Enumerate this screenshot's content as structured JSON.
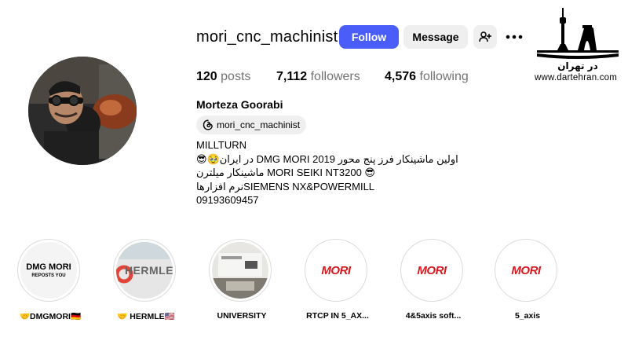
{
  "profile": {
    "username": "mori_cnc_machinist",
    "follow_label": "Follow",
    "message_label": "Message",
    "posts_count": "120",
    "posts_label": "posts",
    "followers_count": "7,112",
    "followers_label": "followers",
    "following_count": "4,576",
    "following_label": "following",
    "full_name": "Morteza Goorabi",
    "threads_handle": "mori_cnc_machinist",
    "bio_lines": [
      "MILLTURN",
      "😎🥹در ایران DMG MORI اولین ماشینکار فرز پنج محور 2019",
      "ماشینکار میلترن MORI SEIKI NT3200 😎",
      "نرم افزارهاSIEMENS NX&POWERMILL",
      "09193609457"
    ]
  },
  "highlights": [
    {
      "label": "🤝DMGMORI🇩🇪",
      "thumb_text": "DMG MORI",
      "thumb_sub": "REPOSTS YOU"
    },
    {
      "label": "🤝 HERMLE🇺🇸",
      "thumb_text": "HERMLE"
    },
    {
      "label": "UNIVERSITY"
    },
    {
      "label": "RTCP IN 5_AX...",
      "thumb_text": "MORI"
    },
    {
      "label": "4&5axis soft...",
      "thumb_text": "MORI"
    },
    {
      "label": "5_axis",
      "thumb_text": "MORI"
    }
  ],
  "watermark": {
    "logo_text": "در تهران",
    "url": "www.dartehran.com"
  },
  "icons": {
    "add_person": "add-person-icon",
    "more": "more-dots-icon",
    "threads": "threads-icon"
  },
  "colors": {
    "follow_button": "#4a5df9",
    "secondary_button": "#efefef",
    "mori_red": "#d71920"
  }
}
